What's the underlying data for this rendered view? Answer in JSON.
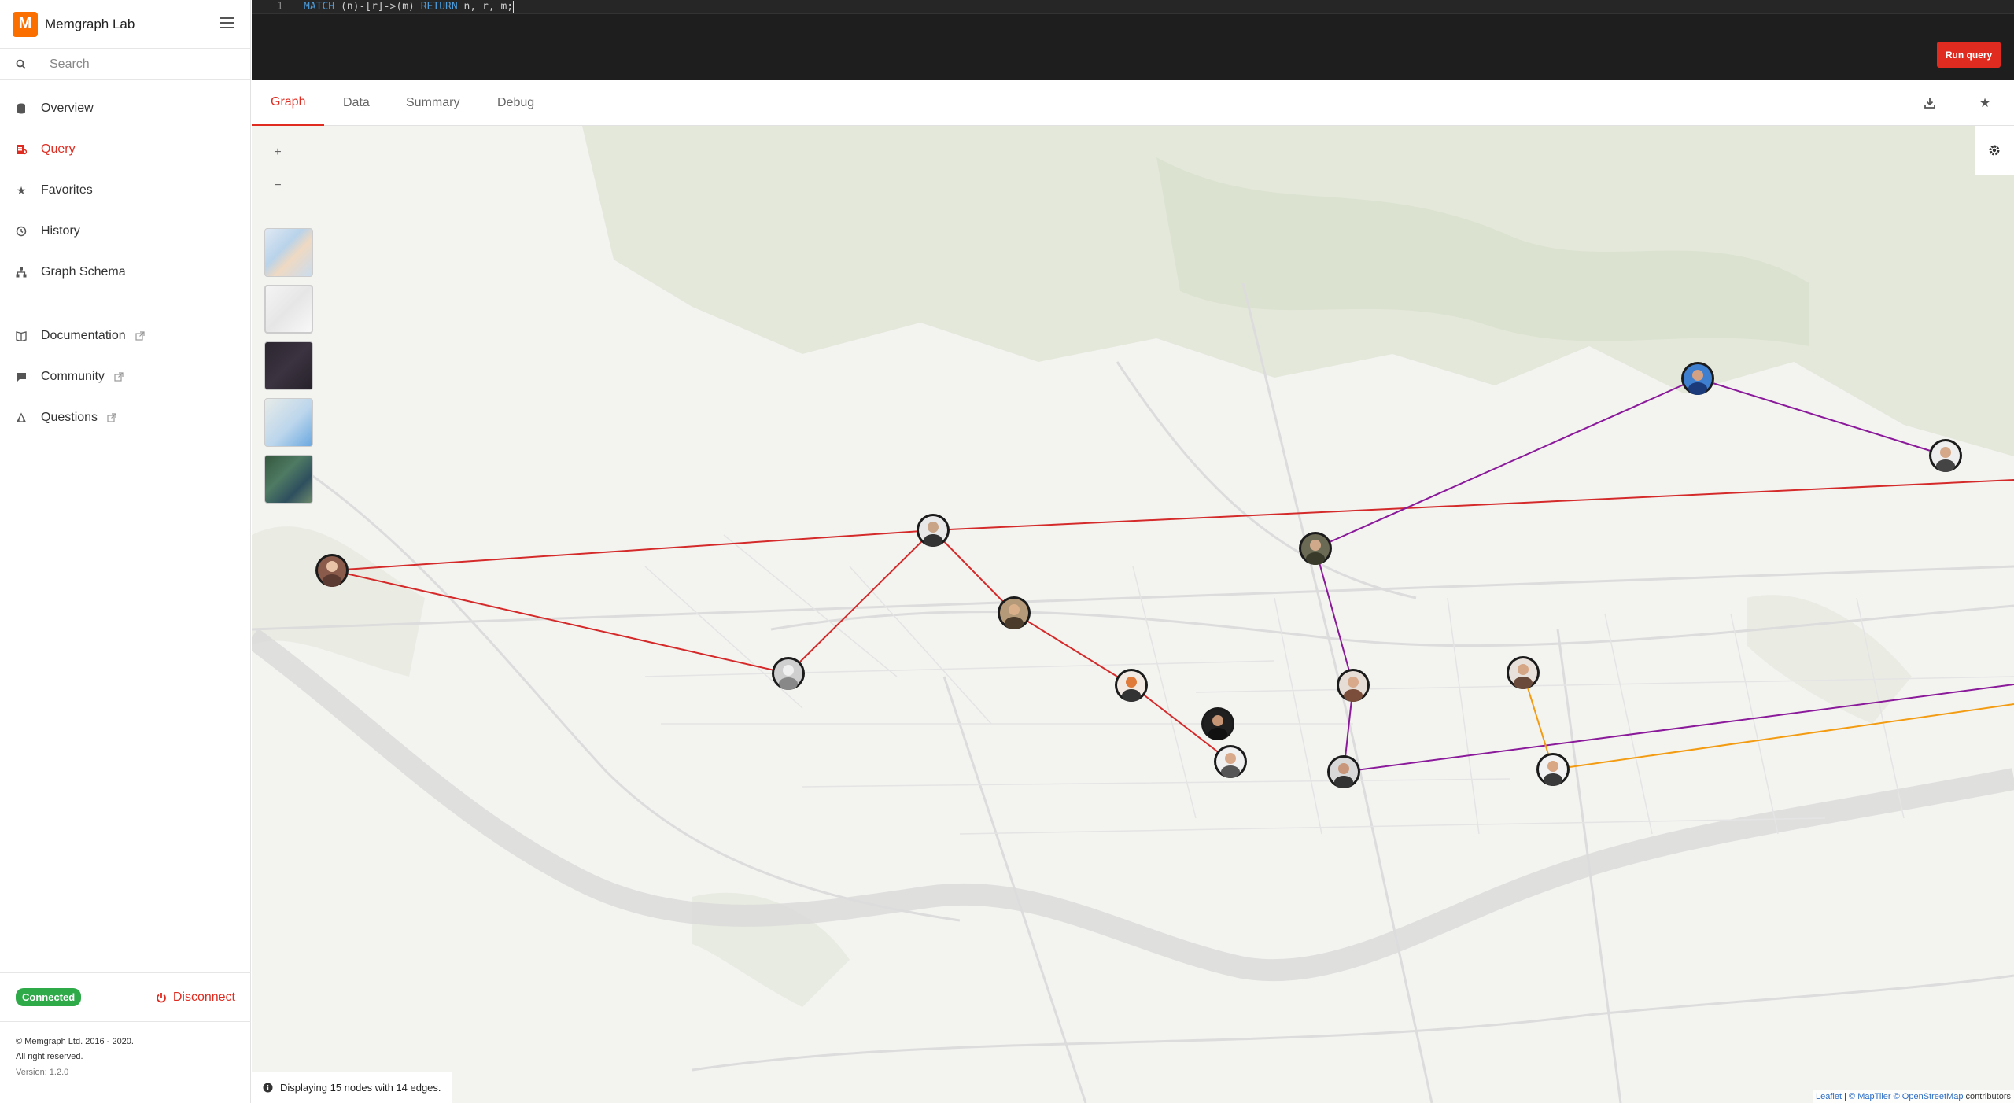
{
  "app": {
    "title": "Memgraph Lab",
    "logo_letter": "M",
    "accent": "#e02b20",
    "logo_color": "#fb6e00"
  },
  "sidebar": {
    "search_placeholder": "Search",
    "nav": [
      {
        "label": "Overview",
        "icon": "database-icon"
      },
      {
        "label": "Query",
        "icon": "query-icon",
        "active": true
      },
      {
        "label": "Favorites",
        "icon": "star-icon"
      },
      {
        "label": "History",
        "icon": "history-icon"
      },
      {
        "label": "Graph Schema",
        "icon": "schema-icon"
      }
    ],
    "links": [
      {
        "label": "Documentation",
        "icon": "book-icon"
      },
      {
        "label": "Community",
        "icon": "chat-icon"
      },
      {
        "label": "Questions",
        "icon": "question-icon"
      }
    ],
    "status": "Connected",
    "status_color": "#2eaa49",
    "disconnect_label": "Disconnect",
    "copyright_line1": "© Memgraph Ltd. 2016 - 2020.",
    "copyright_line2": "All right reserved.",
    "version": "Version: 1.2.0"
  },
  "editor": {
    "line_number": "1",
    "query_kw1": "MATCH",
    "query_mid": " (n)-[r]->(m) ",
    "query_kw2": "RETURN",
    "query_end": " n, r, m;",
    "run_label": "Run query"
  },
  "tabs": [
    {
      "label": "Graph",
      "active": true
    },
    {
      "label": "Data"
    },
    {
      "label": "Summary"
    },
    {
      "label": "Debug"
    }
  ],
  "map": {
    "zoom_in": "+",
    "zoom_out": "−",
    "status_text": "Displaying 15 nodes with 14 edges.",
    "attribution_leaflet": "Leaflet",
    "attribution_sep1": " | ",
    "attribution_maptiler": "© MapTiler",
    "attribution_sep2": " ",
    "attribution_osm": "© OpenStreetMap",
    "attribution_tail": " contributors",
    "edge_colors": {
      "red": "#d42a2a",
      "purple": "#8a1a9a",
      "orange": "#f39c12"
    }
  }
}
